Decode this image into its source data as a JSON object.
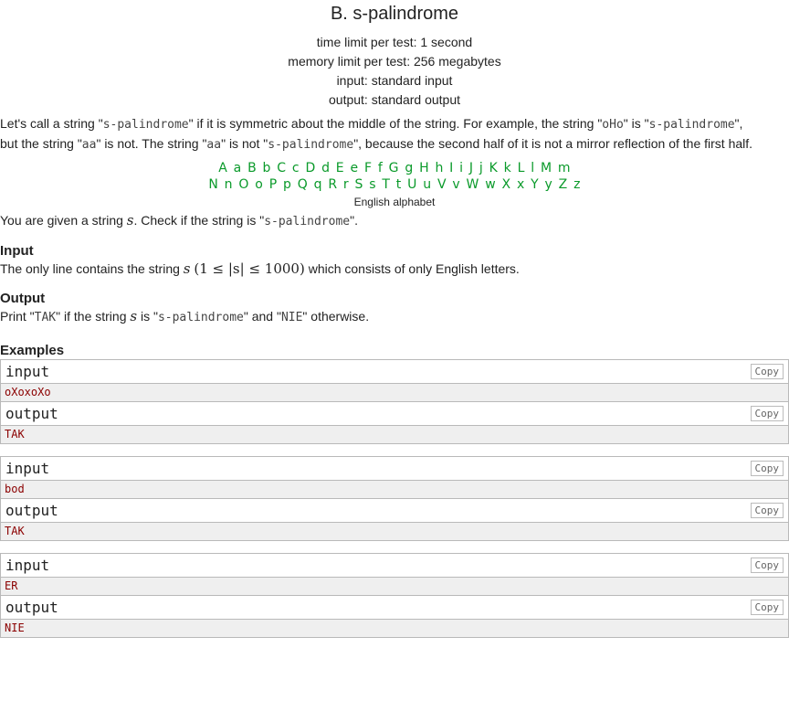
{
  "header": {
    "title": "B. s-palindrome",
    "time_limit": "time limit per test: 1 second",
    "memory_limit": "memory limit per test: 256 megabytes",
    "input": "input: standard input",
    "output": "output: standard output"
  },
  "statement": {
    "p1_a": "Let's call a string \"",
    "p1_code1": "s-palindrome",
    "p1_b": "\" if it is symmetric about the middle of the string. For example, the string \"",
    "p1_code2": "oHo",
    "p1_c": "\" is \"",
    "p1_code3": "s-palindrome",
    "p1_d": "\",",
    "p2_a": "but the string \"",
    "p2_code1": "aa",
    "p2_b": "\" is not. The string \"",
    "p2_code2": "aa",
    "p2_c": "\" is not \"",
    "p2_code3": "s-palindrome",
    "p2_d": "\", because the second half of it is not a mirror reflection of the first half.",
    "alphabet_row1": "A a B b C c D d E e F f G g H h I i J j K k L l M m",
    "alphabet_row2": "N n O o P p Q q R r S s T t U u V v W w X x Y y Z z",
    "alphabet_caption": "English alphabet",
    "given_a": "You are given a string ",
    "given_var": "s",
    "given_b": ". Check if the string is \"",
    "given_code": "s-palindrome",
    "given_c": "\"."
  },
  "input_section": {
    "title": "Input",
    "text_a": "The only line contains the string ",
    "var": "s",
    "constraint": "(1 ≤ |s| ≤ 1000)",
    "text_b": " which consists of only English letters."
  },
  "output_section": {
    "title": "Output",
    "text_a": "Print \"",
    "code1": "TAK",
    "text_b": "\" if the string ",
    "var": "s",
    "text_c": " is \"",
    "code2": "s-palindrome",
    "text_d": "\" and \"",
    "code3": "NIE",
    "text_e": "\" otherwise."
  },
  "examples": {
    "title": "Examples",
    "copy_label": "Copy",
    "input_label": "input",
    "output_label": "output",
    "tests": [
      {
        "input": "oXoxoXo",
        "output": "TAK"
      },
      {
        "input": "bod",
        "output": "TAK"
      },
      {
        "input": "ER",
        "output": "NIE"
      }
    ]
  }
}
